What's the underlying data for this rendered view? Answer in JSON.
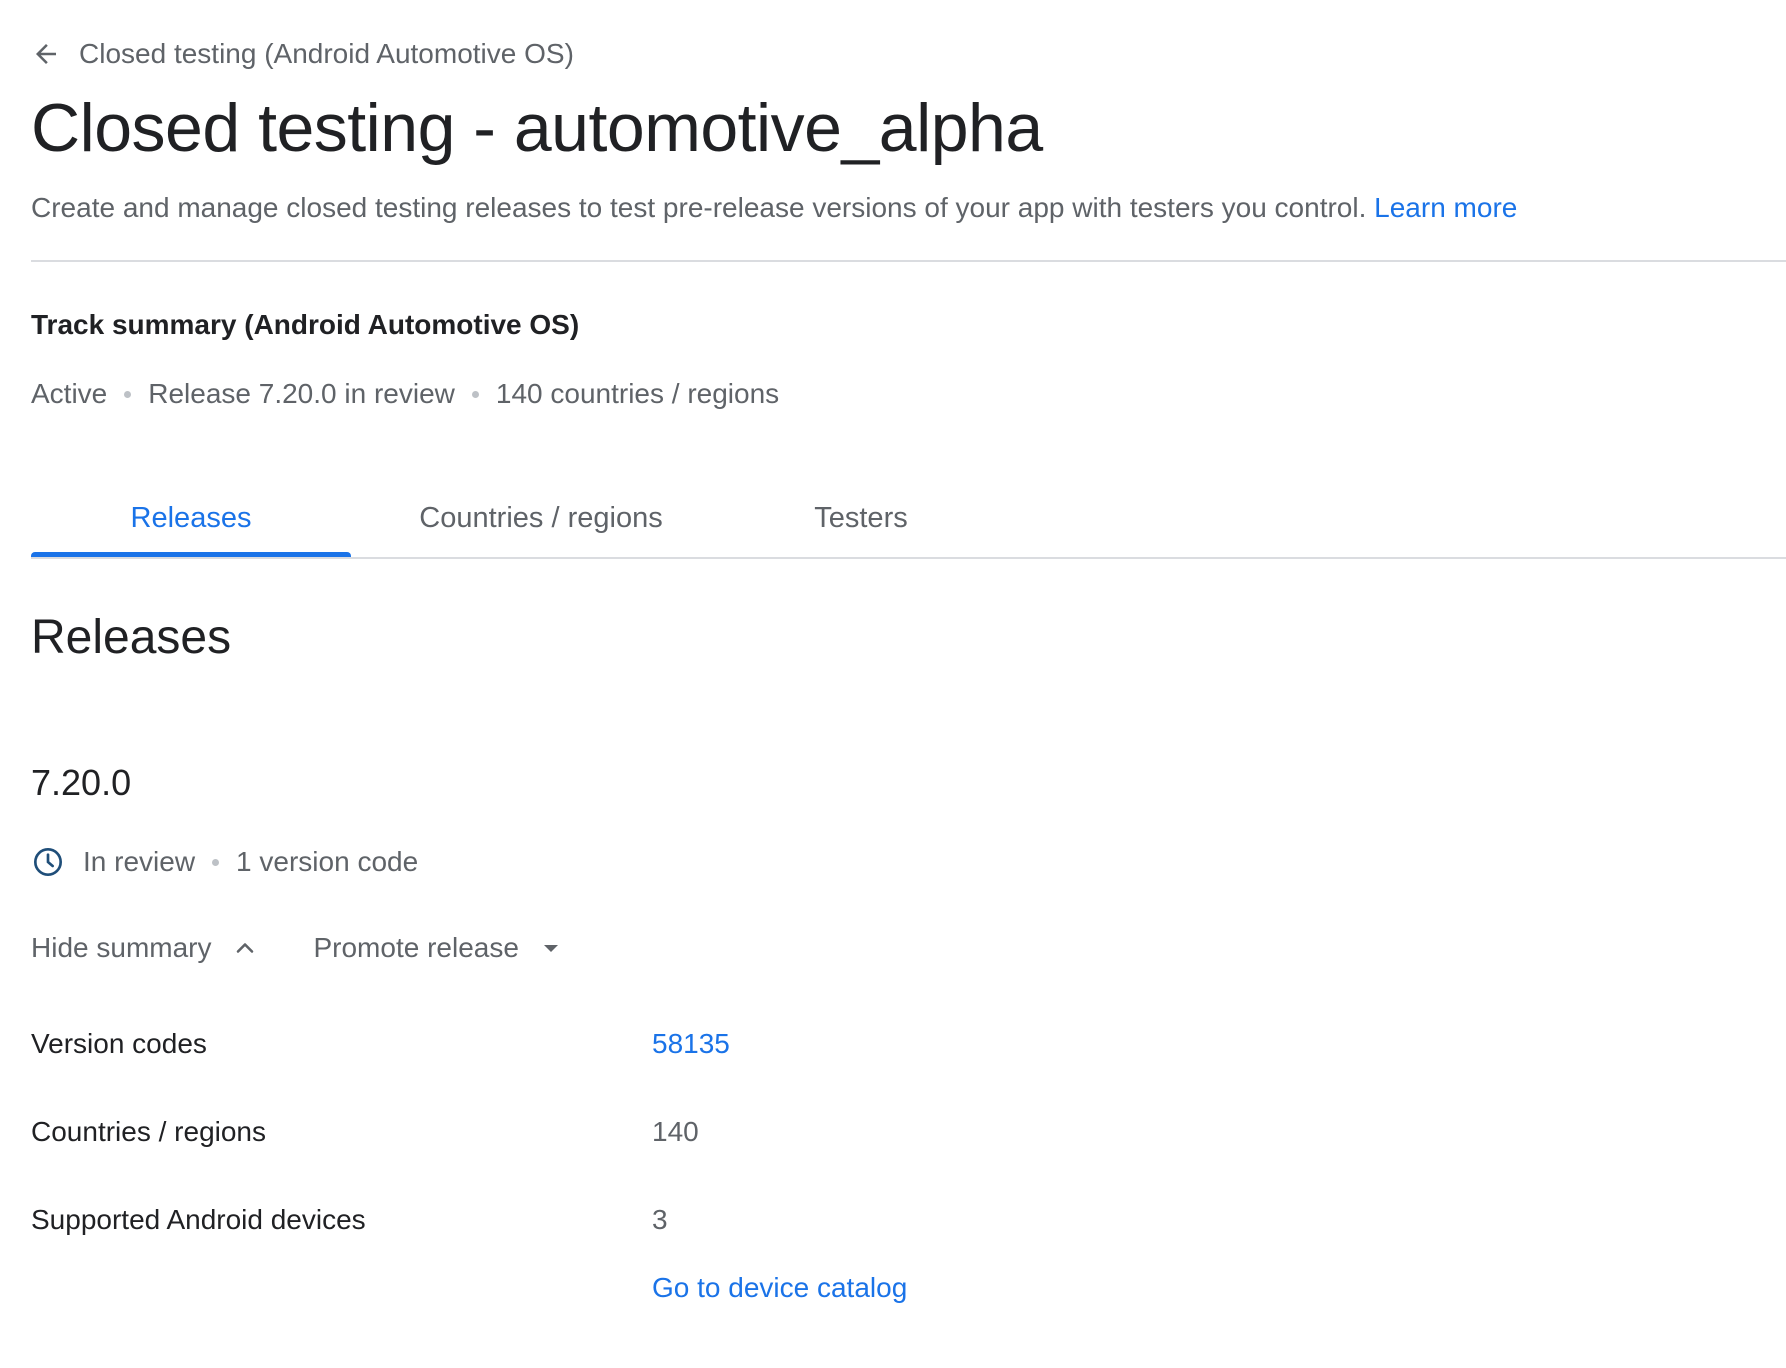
{
  "breadcrumb": {
    "back_icon": "arrow-back-icon",
    "label": "Closed testing (Android Automotive OS)"
  },
  "header": {
    "title": "Closed testing - automotive_alpha",
    "description": "Create and manage closed testing releases to test pre-release versions of your app with testers you control.",
    "learn_more": "Learn more"
  },
  "track_summary": {
    "title": "Track summary (Android Automotive OS)",
    "status": "Active",
    "release": "Release 7.20.0 in review",
    "countries": "140 countries / regions"
  },
  "tabs": [
    {
      "label": "Releases",
      "active": true
    },
    {
      "label": "Countries / regions",
      "active": false
    },
    {
      "label": "Testers",
      "active": false
    }
  ],
  "releases": {
    "section_title": "Releases",
    "release": {
      "version": "7.20.0",
      "status_icon": "clock-icon",
      "status": "In review",
      "version_code_count": "1 version code",
      "hide_summary": "Hide summary",
      "promote_release": "Promote release",
      "summary": [
        {
          "key": "Version codes",
          "value": "58135",
          "is_link": true
        },
        {
          "key": "Countries / regions",
          "value": "140",
          "is_link": false
        },
        {
          "key": "Supported Android devices",
          "value": "3",
          "is_link": false
        }
      ],
      "device_catalog_link": "Go to device catalog"
    }
  },
  "colors": {
    "accent": "#1a73e8",
    "text_primary": "#202124",
    "text_secondary": "#5f6368",
    "divider": "#dadce0"
  }
}
